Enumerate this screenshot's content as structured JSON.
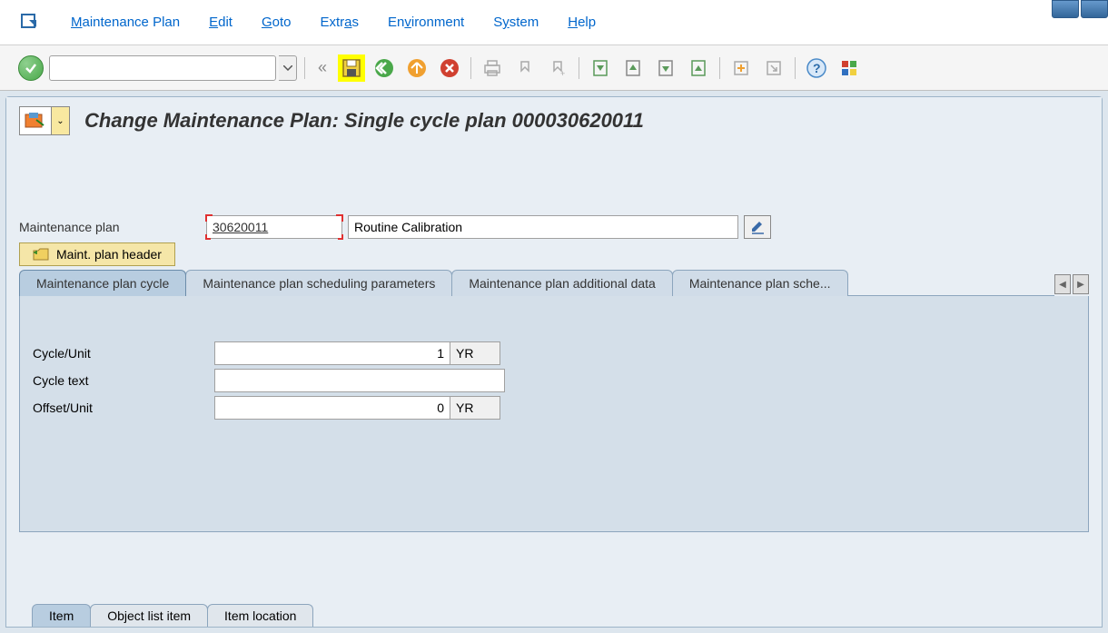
{
  "menubar": {
    "items": [
      {
        "label": "Maintenance Plan",
        "underline": "M"
      },
      {
        "label": "Edit",
        "underline": "E"
      },
      {
        "label": "Goto",
        "underline": "G"
      },
      {
        "label": "Extras",
        "underline": ""
      },
      {
        "label": "Environment",
        "underline": ""
      },
      {
        "label": "System",
        "underline": ""
      },
      {
        "label": "Help",
        "underline": "H"
      }
    ]
  },
  "screen": {
    "title": "Change Maintenance Plan: Single cycle plan 000030620011"
  },
  "fields": {
    "plan_label": "Maintenance plan",
    "plan_value": "30620011",
    "desc_value": "Routine Calibration",
    "header_btn": "Maint. plan header"
  },
  "tabs": {
    "items": [
      "Maintenance plan cycle",
      "Maintenance plan scheduling parameters",
      "Maintenance plan additional data",
      "Maintenance plan sche..."
    ],
    "active": 0
  },
  "panel": {
    "cycle_label": "Cycle/Unit",
    "cycle_value": "1",
    "cycle_unit": "YR",
    "text_label": "Cycle text",
    "text_value": "",
    "offset_label": "Offset/Unit",
    "offset_value": "0",
    "offset_unit": "YR"
  },
  "bottom_tabs": {
    "items": [
      "Item",
      "Object list item",
      "Item location"
    ],
    "active": 0
  }
}
